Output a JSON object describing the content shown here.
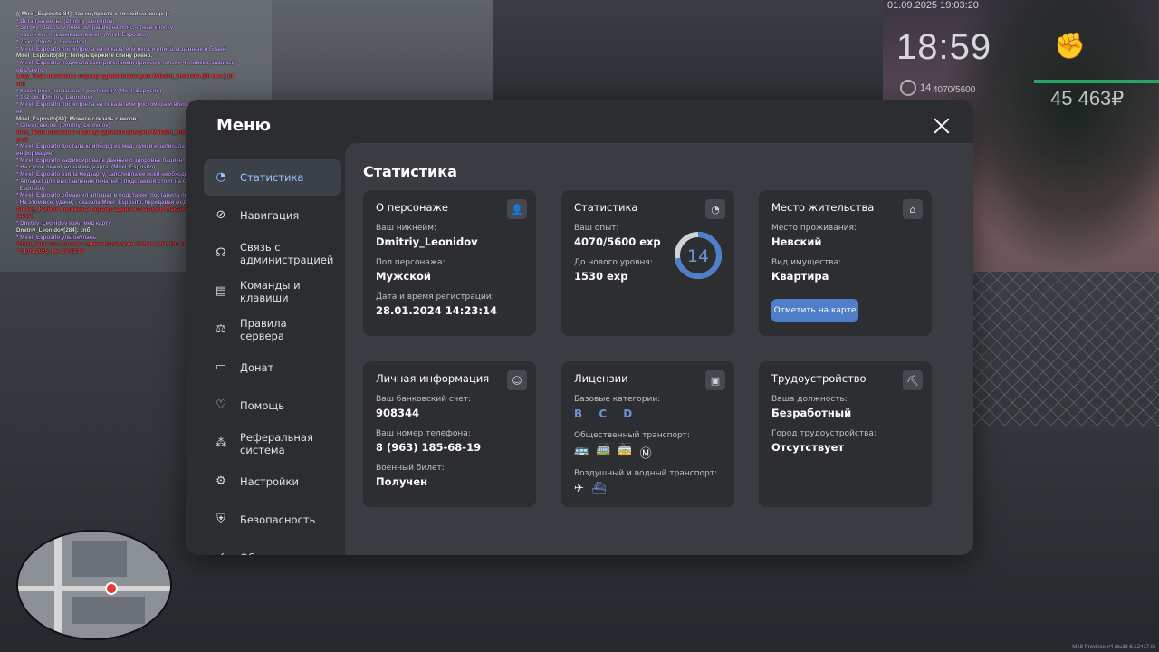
{
  "hud": {
    "datetime": "01.09.2025 19:03:20",
    "time": "18:59",
    "level": "14",
    "exp": "4070/5600",
    "money": "45 463₽",
    "fist_icon": "fist-icon"
  },
  "chat": [
    {
      "c": "w",
      "t": "(( Mirel_Esposito[84]: так же,просто с точкой на конце ))"
    },
    {
      "c": "p",
      "t": "* Встал на весы. (Dmitriy_Leonidov)"
    },
    {
      "c": "p",
      "t": "* Sergey_Babosov повесил рацию на пояс, отжав кнопку"
    },
    {
      "c": "p",
      "t": "* Какой вес показывают весы? (Mirel_Esposito)"
    },
    {
      "c": "p",
      "t": "* 75 кг. (Dmitriy_Leonidov)"
    },
    {
      "c": "p",
      "t": "* Mirel_Esposito посмотрела на показатели веса и вписала данные в бланк"
    },
    {
      "c": "w",
      "t": "Mirel_Esposito[84]: Теперь держите спину ровно."
    },
    {
      "c": "p",
      "t": "* Mirel_Esposito поднесла измерительный прибор к голове человека, зафиксир"
    },
    {
      "c": "p",
      "t": "овала его"
    },
    {
      "c": "r",
      "t": "Lexy_Tesla посажен в тюрьму администратором Maksim_Umbrella (30 мин.) (d"
    },
    {
      "c": "r",
      "t": "sp)"
    },
    {
      "c": "p",
      "t": "* Какой рост показывает ростомер? (Mirel_Esposito)"
    },
    {
      "c": "p",
      "t": "* 182 см. (Dmitriy_Leonidov)"
    },
    {
      "c": "p",
      "t": "* Mirel_Esposito посмотрела на показатели ростомера и вписала данные в бла"
    },
    {
      "c": "p",
      "t": "нк"
    },
    {
      "c": "w",
      "t": "Mirel_Esposito[84]: Можете слезать с весов."
    },
    {
      "c": "p",
      "t": "* Слез с весов. (Dmitriy_Leonidov)"
    },
    {
      "c": "r",
      "t": "Alex_Tesla посажен в тюрьму администратором Maksim_Umbrella (30 мин.) (d"
    },
    {
      "c": "r",
      "t": "ped)"
    },
    {
      "c": "p",
      "t": "* Mirel_Esposito достала клипборд из мед. сумки и записала всю необходимую"
    },
    {
      "c": "p",
      "t": "информацию"
    },
    {
      "c": "p",
      "t": "* Mirel_Esposito зафиксировала данные о здоровье пациента в бланк"
    },
    {
      "c": "p",
      "t": "* На столе лежит новая медкарта. (Mirel_Esposito)"
    },
    {
      "c": "p",
      "t": "* Mirel_Esposito взяла медкарту, заполнила ее всей необходимой информацией"
    },
    {
      "c": "p",
      "t": "* Аппарат для выставления печатей с подставкой стоит на столе. (Mirel"
    },
    {
      "c": "p",
      "t": "_Esposito)"
    },
    {
      "c": "p",
      "t": "* Mirel_Esposito обмакнул аппарат в подставке, поставила печать"
    },
    {
      "c": "p",
      "t": "- На этом все, удачи, - сказала Mirel_Esposito, передавая медкарту гражданину."
    },
    {
      "c": "r",
      "t": "Andrey_Kulikov посажен в тюрьму администратором Maksim_Umbrella (30 мин.)"
    },
    {
      "c": "r",
      "t": "(срез)"
    },
    {
      "c": "p",
      "t": "* Dmitriy_Leonidov взял мед карту"
    },
    {
      "c": "w",
      "t": "Dmitriy_Leonidov[284]: спб"
    },
    {
      "c": "p",
      "t": "* Mirel_Esposito улыбнулась"
    },
    {
      "c": "r",
      "t": "Vitalii_Terie был заткнут администратором Sabrine_Ilio (30 мин.) (мат в репорт)"
    },
    {
      "c": "r",
      "t": "* 01.09.2025, Пн, 19:03:19"
    }
  ],
  "menu": {
    "title": "Меню",
    "nav": [
      {
        "label": "Статистика",
        "icon": "pie-chart-icon",
        "active": true
      },
      {
        "label": "Навигация",
        "icon": "compass-icon",
        "active": false
      },
      {
        "label": "Связь с администрацией",
        "icon": "headset-icon",
        "active": false
      },
      {
        "label": "Команды и клавиши",
        "icon": "document-icon",
        "active": false
      },
      {
        "label": "Правила сервера",
        "icon": "scales-icon",
        "active": false
      },
      {
        "label": "Донат",
        "icon": "wallet-icon",
        "active": false
      },
      {
        "label": "Помощь",
        "icon": "heart-hand-icon",
        "active": false
      },
      {
        "label": "Реферальная система",
        "icon": "people-network-icon",
        "active": false
      },
      {
        "label": "Настройки",
        "icon": "gear-icon",
        "active": false
      },
      {
        "label": "Безопасность",
        "icon": "shield-icon",
        "active": false
      },
      {
        "label": "Обновления",
        "icon": "check-circle-icon",
        "active": false
      }
    ]
  },
  "stats": {
    "title": "Статистика",
    "character": {
      "title": "О персонаже",
      "icon": "user-icon",
      "nickname_label": "Ваш никнейм:",
      "nickname": "Dmitriy_Leonidov",
      "gender_label": "Пол персонажа:",
      "gender": "Мужской",
      "reg_label": "Дата и время регистрации:",
      "reg": "28.01.2024 14:23:14"
    },
    "statistic": {
      "title": "Статистика",
      "icon": "clock-pie-icon",
      "exp_label": "Ваш опыт:",
      "exp": "4070/5600 exp",
      "next_label": "До нового уровня:",
      "next": "1530 exp",
      "level": "14",
      "level_progress": 0.727,
      "ring_color": "#4e7fc8"
    },
    "residence": {
      "title": "Место жительства",
      "icon": "house-icon",
      "place_label": "Место проживания:",
      "place": "Невский",
      "property_label": "Вид имущества:",
      "property": "Квартира",
      "map_button": "Отметить на карте"
    },
    "personal": {
      "title": "Личная информация",
      "icon": "person-circle-icon",
      "bank_label": "Ваш банковский счет:",
      "bank": "908344",
      "phone_label": "Ваш номер телефона:",
      "phone": "8 (963) 185-68-19",
      "military_label": "Военный билет:",
      "military": "Получен"
    },
    "licenses": {
      "title": "Лицензии",
      "icon": "id-card-icon",
      "basic_label": "Базовые категории:",
      "basic": "B C D",
      "public_label": "Общественный транспорт:",
      "air_label": "Воздушный и водный транспорт:"
    },
    "employment": {
      "title": "Трудоустройство",
      "icon": "pickaxe-icon",
      "position_label": "Ваша должность:",
      "position": "Безработный",
      "city_label": "Город трудоустройства:",
      "city": "Отсутствует"
    }
  },
  "build": "M18 Province #4 (build 6.12417.0)"
}
